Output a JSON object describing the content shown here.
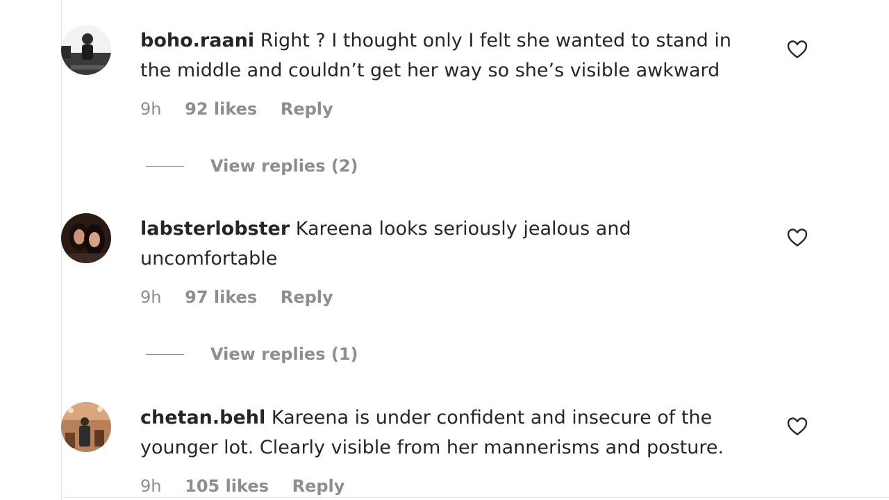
{
  "comments": [
    {
      "username": "boho.raani",
      "text": "Right ? I thought only I felt she wanted to stand in the middle and couldn’t get her way so she’s visible awkward",
      "time": "9h",
      "likes": "92 likes",
      "reply": "Reply",
      "view_replies": "View replies (2)"
    },
    {
      "username": "labsterlobster",
      "text": "Kareena looks seriously jealous and uncomfortable",
      "time": "9h",
      "likes": "97 likes",
      "reply": "Reply",
      "view_replies": "View replies (1)"
    },
    {
      "username": "chetan.behl",
      "text": "Kareena is under confident and insecure of the younger lot. Clearly visible from her mannerisms and posture.",
      "time": "9h",
      "likes": "105 likes",
      "reply": "Reply"
    }
  ],
  "icons": {
    "like": "heart-outline-icon"
  },
  "colors": {
    "text": "#262626",
    "secondary": "#8e8e8e",
    "border": "#e6e6e6"
  }
}
